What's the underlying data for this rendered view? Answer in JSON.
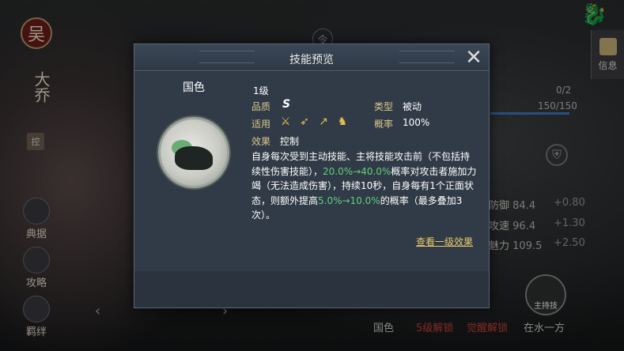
{
  "bg": {
    "badge": "吴",
    "general_name": "大乔",
    "tag": "控",
    "left_buttons": [
      "典据",
      "攻略",
      "羁绊"
    ],
    "ling": "令",
    "info_label": "信息",
    "count_a": "0/2",
    "count_b": "150/150",
    "stats": [
      {
        "label": "防御",
        "value": "84.4",
        "bonus": "+0.80"
      },
      {
        "label": "攻速",
        "value": "96.4",
        "bonus": "+1.30"
      },
      {
        "label": "魅力",
        "value": "109.5",
        "bonus": "+2.50"
      }
    ],
    "bottom_items": [
      "国色",
      "5级解锁",
      "觉醒解锁",
      "在水一方"
    ],
    "skill_circle_label": "主持技",
    "colors": {
      "bottom_red": "#c8433a",
      "bottom_default": "#d0d0d0"
    }
  },
  "modal": {
    "title": "技能预览",
    "close_icon": "crossed-swords-icon",
    "skill_name": "国色",
    "tier": "1级",
    "quality_label": "品质",
    "quality_value": "S",
    "type_label": "类型",
    "type_value": "被动",
    "apply_label": "适用",
    "troops": [
      "cavalry-sword-icon",
      "bow-icon",
      "spear-icon",
      "horse-icon"
    ],
    "chance_label": "概率",
    "chance_value": "100%",
    "effect_label": "效果",
    "effect_value": "控制",
    "desc_1": "自身每次受到主动技能、主将技能攻击前（不包括持续性伤害技能），",
    "desc_g1": "20.0%→40.0%",
    "desc_2": "概率对攻击者施加力竭（无法造成伤害），持续10秒，自身每有1个正面状态，则额外提高",
    "desc_g2": "5.0%→10.0%",
    "desc_3": "的概率（最多叠加3次）。",
    "link": "查看一级效果"
  }
}
